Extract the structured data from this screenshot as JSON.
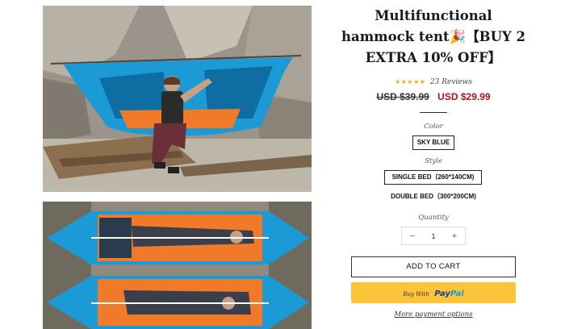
{
  "product": {
    "title": "Multifunctional hammock tent🎉【BUY 2 EXTRA 10% OFF】",
    "rating": {
      "stars": "★★★★★",
      "value": 5,
      "reviews": "23 Reviews"
    },
    "price_original": "USD $39.99",
    "price_sale": "USD $29.99"
  },
  "options": {
    "color_label": "Color",
    "color_value": "SKY BLUE",
    "style_label": "Style",
    "style_values": [
      "SINGLE BED（260*140CM)",
      "DOUBLE BED（300*200CM)"
    ],
    "quantity_label": "Quantity",
    "quantity_value": "1",
    "minus": "−",
    "plus": "+"
  },
  "actions": {
    "add_to_cart": "ADD TO CART",
    "paypal_prefix": "Buy With",
    "paypal_brand_1": "Pay",
    "paypal_brand_2": "Pal",
    "more_payment": "More payment options"
  },
  "colors": {
    "sale_price": "#b0131d",
    "star": "#f0a81c",
    "paypal_button": "#fbc43a",
    "hammock_blue": "#1c9ad6",
    "mat_orange": "#f07a2a"
  }
}
